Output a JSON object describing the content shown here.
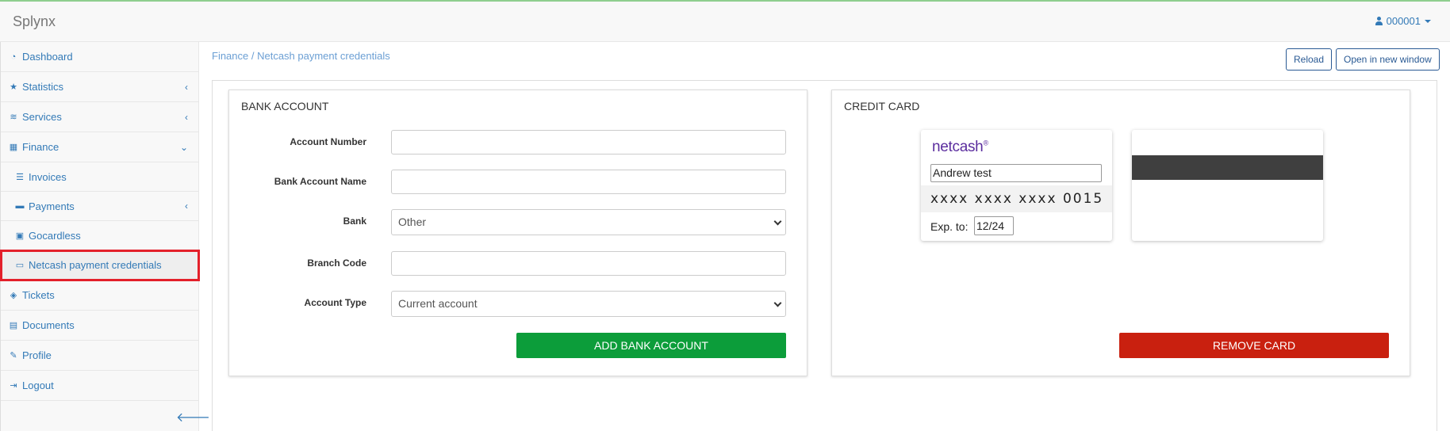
{
  "app": {
    "brand": "Splynx",
    "user": "000001"
  },
  "sidebar": {
    "items": [
      {
        "label": "Dashboard",
        "icon": "dashboard-icon"
      },
      {
        "label": "Statistics",
        "icon": "star-icon"
      },
      {
        "label": "Services",
        "icon": "wifi-icon"
      },
      {
        "label": "Finance",
        "icon": "calculator-icon"
      },
      {
        "label": "Invoices",
        "icon": "list-icon"
      },
      {
        "label": "Payments",
        "icon": "archive-icon"
      },
      {
        "label": "Gocardless",
        "icon": "id-card-icon"
      },
      {
        "label": "Netcash payment credentials",
        "icon": "credit-card-icon"
      },
      {
        "label": "Tickets",
        "icon": "ticket-icon"
      },
      {
        "label": "Documents",
        "icon": "document-icon"
      },
      {
        "label": "Profile",
        "icon": "pencil-icon"
      },
      {
        "label": "Logout",
        "icon": "logout-icon"
      }
    ],
    "active": "Netcash payment credentials"
  },
  "breadcrumb": "Finance / Netcash payment credentials",
  "toolbar": {
    "reload": "Reload",
    "open_new_window": "Open in new window"
  },
  "bank_account": {
    "title": "BANK ACCOUNT",
    "fields": {
      "account_number": {
        "label": "Account Number",
        "value": ""
      },
      "bank_account_name": {
        "label": "Bank Account Name",
        "value": ""
      },
      "bank": {
        "label": "Bank",
        "value": "Other"
      },
      "branch_code": {
        "label": "Branch Code",
        "value": ""
      },
      "account_type": {
        "label": "Account Type",
        "value": "Current account"
      }
    },
    "add_button": "ADD BANK ACCOUNT"
  },
  "credit_card": {
    "title": "CREDIT CARD",
    "logo": "netcash",
    "cardholder": "Andrew test",
    "number": "xxxx xxxx xxxx 0015",
    "exp_label": "Exp. to:",
    "exp_value": "12/24",
    "remove_button": "REMOVE CARD"
  },
  "colors": {
    "link": "#337ab7",
    "green": "#0c9d3a",
    "red": "#c9200f",
    "highlight": "#e3202a",
    "brand_purple": "#5b2d9e"
  }
}
